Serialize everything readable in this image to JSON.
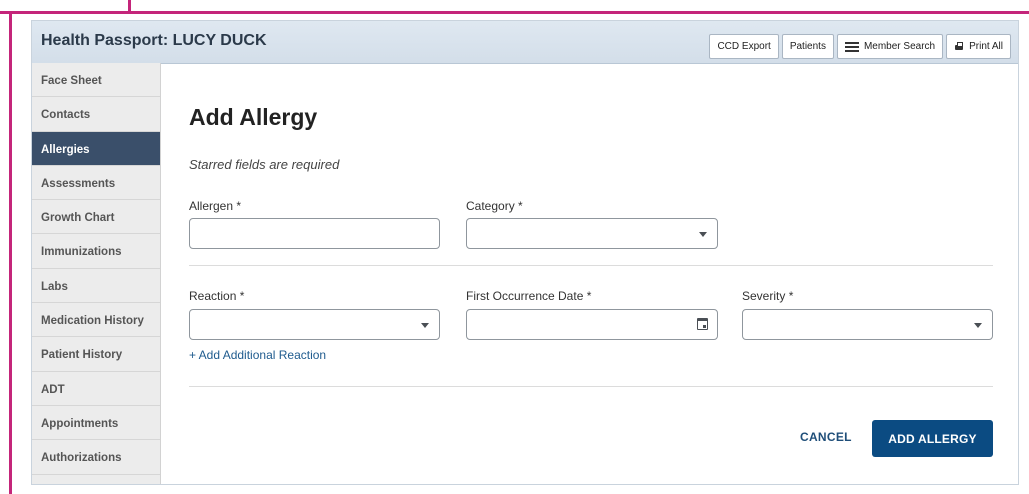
{
  "header": {
    "title": "Health Passport: LUCY DUCK",
    "buttons": {
      "ccd_export": "CCD Export",
      "patients": "Patients",
      "member_search": "Member Search",
      "print_all": "Print All"
    }
  },
  "sidebar": {
    "items": [
      {
        "label": "Face Sheet"
      },
      {
        "label": "Contacts"
      },
      {
        "label": "Allergies"
      },
      {
        "label": "Assessments"
      },
      {
        "label": "Growth Chart"
      },
      {
        "label": "Immunizations"
      },
      {
        "label": "Labs"
      },
      {
        "label": "Medication History"
      },
      {
        "label": "Patient History"
      },
      {
        "label": "ADT"
      },
      {
        "label": "Appointments"
      },
      {
        "label": "Authorizations"
      }
    ],
    "active_item": "Allergies"
  },
  "form": {
    "heading": "Add Allergy",
    "required_note": "Starred fields are required",
    "allergen": {
      "label": "Allergen",
      "value": ""
    },
    "category": {
      "label": "Category",
      "value": ""
    },
    "reaction": {
      "label": "Reaction",
      "value": ""
    },
    "first_occurrence_date": {
      "label": "First Occurrence Date",
      "value": ""
    },
    "severity": {
      "label": "Severity",
      "value": ""
    },
    "required_marker": "*",
    "add_reaction_link": "+ Add Additional Reaction",
    "cancel_label": "CANCEL",
    "submit_label": "ADD ALLERGY"
  },
  "icons": {
    "member_search": "hamburger-menu-icon",
    "print_all": "printer-icon",
    "dropdown": "chevron-down-icon",
    "date": "calendar-icon"
  },
  "colors": {
    "accent": "#0b4b82",
    "active_sidebar": "#3a4f6a",
    "frame": "#c4257a",
    "link": "#1f5b8e"
  }
}
